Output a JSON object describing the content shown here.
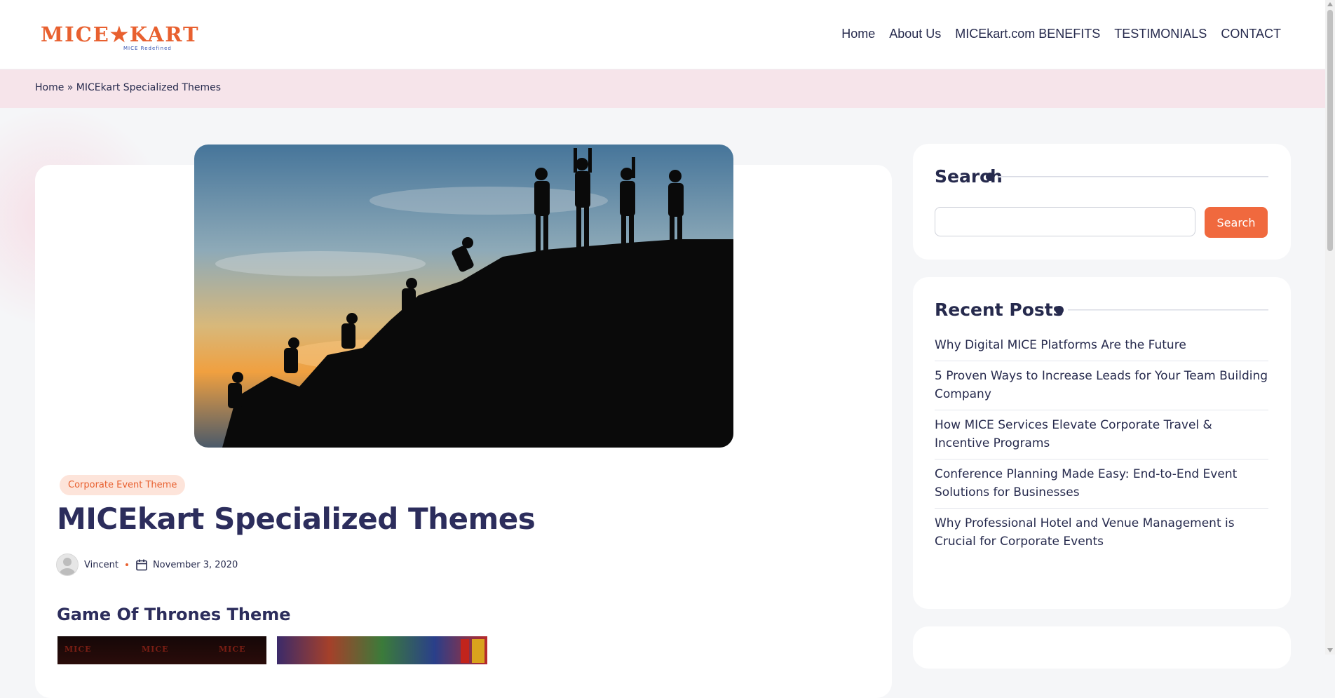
{
  "site": {
    "logo_text": "MICE★KART",
    "logo_tagline": "MICE Redefined"
  },
  "nav": {
    "items": [
      "Home",
      "About Us",
      "MICEkart.com BENEFITS",
      "TESTIMONIALS",
      "CONTACT"
    ]
  },
  "breadcrumb": "Home » MICEkart Specialized Themes",
  "article": {
    "hero_icon": "mountain-team-silhouette-image",
    "category": "Corporate Event Theme",
    "title": "MICEkart Specialized Themes",
    "author": "Vincent",
    "date": "November 3, 2020",
    "subheading": "Game Of Thrones Theme"
  },
  "sidebar": {
    "search": {
      "title": "Search",
      "input_value": "",
      "button_label": "Search"
    },
    "recent_posts": {
      "title": "Recent Posts",
      "items": [
        "Why Digital MICE Platforms Are the Future",
        "5 Proven Ways to Increase Leads for Your Team Building Company",
        "How MICE Services Elevate Corporate Travel & Incentive Programs",
        "Conference Planning Made Easy: End-to-End Event Solutions for Businesses",
        "Why Professional Hotel and Venue Management is Crucial for Corporate Events"
      ]
    }
  },
  "colors": {
    "accent": "#f0693e",
    "text": "#262a4d",
    "breadcrumb_bg": "#f6e4ea",
    "page_bg": "#f5f6f8"
  }
}
